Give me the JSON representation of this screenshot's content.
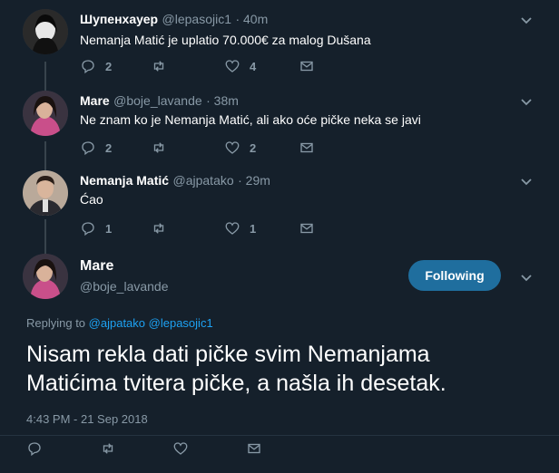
{
  "tweets": [
    {
      "name": "Шупенхауер",
      "handle": "@lepasojic1",
      "time": "· 40m",
      "text": "Nemanja Matić je uplatio 70.000€ za malog Dušana",
      "reply_count": "2",
      "retweet_count": "",
      "like_count": "4"
    },
    {
      "name": "Mare",
      "handle": "@boje_lavande",
      "time": "· 38m",
      "text": "Ne znam ko je Nemanja Matić, ali ako oće pičke neka se javi",
      "reply_count": "2",
      "retweet_count": "",
      "like_count": "2"
    },
    {
      "name": "Nemanja Matić",
      "handle": "@ajpatako",
      "time": "· 29m",
      "text": "Ćao",
      "reply_count": "1",
      "retweet_count": "",
      "like_count": "1"
    }
  ],
  "main": {
    "name": "Mare",
    "handle": "@boje_lavande",
    "follow_label": "Following",
    "replying_prefix": "Replying to",
    "replying_users": [
      "@ajpatako",
      "@lepasojic1"
    ],
    "text_line1": "Nisam rekla dati pičke svim Nemanjama",
    "text_line2": "Matićima tvitera pičke, a našla ih desetak.",
    "timestamp": "4:43 PM - 21 Sep 2018"
  },
  "icons": [
    "reply-icon",
    "retweet-icon",
    "like-icon",
    "dm-icon",
    "chevron-down-icon"
  ],
  "colors": {
    "background": "#15202b",
    "accent": "#1da1f2",
    "button": "#1f6e9e",
    "muted": "#8899a6"
  }
}
